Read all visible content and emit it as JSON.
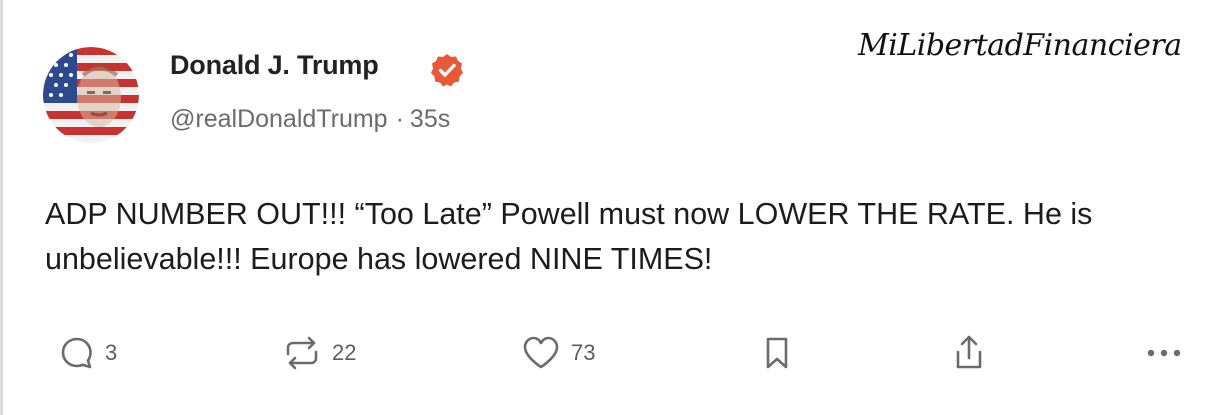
{
  "author": {
    "display_name": "Donald J. Trump",
    "handle": "@realDonaldTrump",
    "separator": "·",
    "time_ago": "35s",
    "verified_icon": "verified-badge-icon",
    "verified_color": "#e8593a"
  },
  "watermark": "MiLibertadFinanciera",
  "post": {
    "text": "ADP NUMBER OUT!!! “Too Late” Powell must now LOWER THE RATE. He is unbelievable!!! Europe has lowered NINE TIMES!"
  },
  "actions": {
    "reply": {
      "icon": "reply-icon",
      "count": "3"
    },
    "repost": {
      "icon": "repost-icon",
      "count": "22"
    },
    "like": {
      "icon": "heart-icon",
      "count": "73"
    },
    "bookmark": {
      "icon": "bookmark-icon"
    },
    "share": {
      "icon": "share-icon"
    },
    "more": {
      "icon": "more-icon"
    }
  }
}
